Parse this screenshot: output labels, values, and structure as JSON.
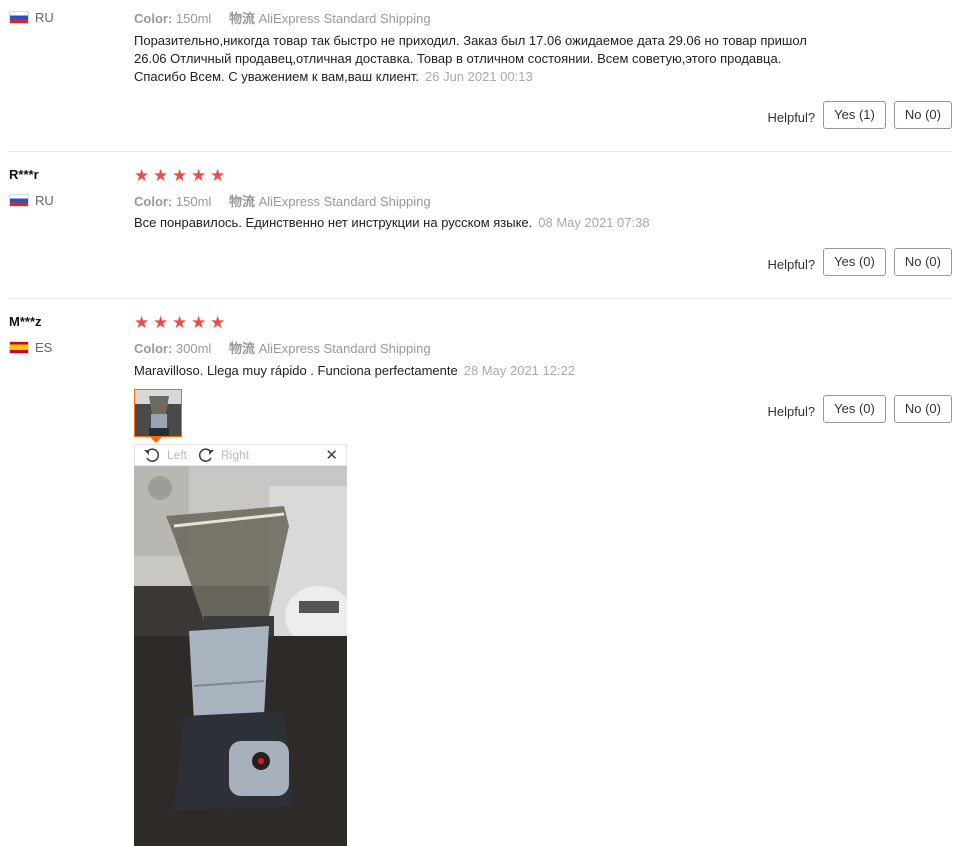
{
  "labels": {
    "color_key": "Color:",
    "shipping_key": "物流",
    "helpful": "Helpful?"
  },
  "reviews": [
    {
      "user": "",
      "country": "RU",
      "color": "150ml",
      "shipping": "AliExpress Standard Shipping",
      "text_lines": [
        "Поразительно,никогда товар так быстро не приходил. Заказ был 17.06 ожидаемое дата 29.06 но товар пришол",
        "26.06 Отличный продавец,отличная доставка. Товар в отличном состоянии. Всем советую,этого продавца.",
        "Спасибо Всем. С уважением к вам,ваш клиент."
      ],
      "date": "26 Jun 2021 00:13",
      "yes": "Yes (1)",
      "no": "No (0)"
    },
    {
      "user": "R***r",
      "country": "RU",
      "rating": 5,
      "color": "150ml",
      "shipping": "AliExpress Standard Shipping",
      "text": "Все понравилось. Единственно нет инструкции на русском языке.",
      "date": "08 May 2021 07:38",
      "yes": "Yes (0)",
      "no": "No (0)"
    },
    {
      "user": "M***z",
      "country": "ES",
      "rating": 5,
      "color": "300ml",
      "shipping": "AliExpress Standard Shipping",
      "text": "Maravilloso. Llega muy rápido . Funciona perfectamente",
      "date": "28 May 2021 12:22",
      "yes": "Yes (0)",
      "no": "No (0)"
    }
  ],
  "viewer": {
    "left": "Left",
    "right": "Right"
  },
  "colors": {
    "star": "#f2494a",
    "accent": "#ff6a00"
  }
}
